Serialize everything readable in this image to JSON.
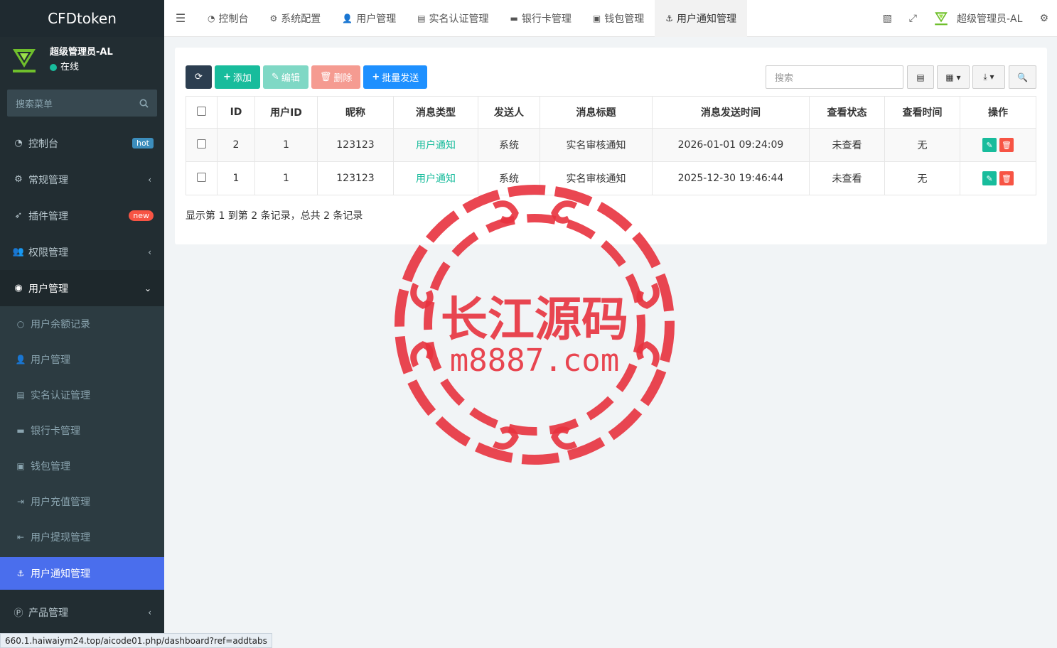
{
  "sidebar": {
    "brand": "CFDtoken",
    "user_name": "超级管理员-AL",
    "user_status": "在线",
    "search_placeholder": "搜索菜单",
    "items": [
      {
        "label": "控制台",
        "icon": "dashboard-icon",
        "badge": "hot"
      },
      {
        "label": "常规管理",
        "icon": "cogs-icon",
        "chevron": "‹"
      },
      {
        "label": "插件管理",
        "icon": "rocket-icon",
        "badge": "new"
      },
      {
        "label": "权限管理",
        "icon": "group-icon",
        "chevron": "‹"
      },
      {
        "label": "用户管理",
        "icon": "user-circle-icon",
        "chevron": "⌄"
      }
    ],
    "subitems": [
      {
        "label": "用户余额记录",
        "icon": "circle-o-icon"
      },
      {
        "label": "用户管理",
        "icon": "user-icon"
      },
      {
        "label": "实名认证管理",
        "icon": "id-card-icon"
      },
      {
        "label": "银行卡管理",
        "icon": "credit-card-icon"
      },
      {
        "label": "钱包管理",
        "icon": "money-icon"
      },
      {
        "label": "用户充值管理",
        "icon": "sign-in-icon"
      },
      {
        "label": "用户提现管理",
        "icon": "sign-out-icon"
      },
      {
        "label": "用户通知管理",
        "icon": "anchor-icon"
      }
    ],
    "last_item": {
      "label": "产品管理",
      "icon": "product-icon",
      "chevron": "‹"
    }
  },
  "topnav": {
    "tabs": [
      {
        "label": "控制台",
        "icon": "dashboard-icon"
      },
      {
        "label": "系统配置",
        "icon": "gear-icon"
      },
      {
        "label": "用户管理",
        "icon": "user-icon"
      },
      {
        "label": "实名认证管理",
        "icon": "id-card-icon"
      },
      {
        "label": "银行卡管理",
        "icon": "credit-card-icon"
      },
      {
        "label": "钱包管理",
        "icon": "money-icon"
      },
      {
        "label": "用户通知管理",
        "icon": "anchor-icon"
      }
    ],
    "admin_name": "超级管理员-AL"
  },
  "toolbar": {
    "add": "添加",
    "edit": "编辑",
    "delete": "删除",
    "batch": "批量发送",
    "search_placeholder": "搜索"
  },
  "table": {
    "headers": [
      "ID",
      "用户ID",
      "昵称",
      "消息类型",
      "发送人",
      "消息标题",
      "消息发送时间",
      "查看状态",
      "查看时间",
      "操作"
    ],
    "rows": [
      {
        "id": "2",
        "user_id": "1",
        "nickname": "123123",
        "type": "用户通知",
        "sender": "系统",
        "title": "实名审核通知",
        "time": "2026-01-01 09:24:09",
        "status": "未查看",
        "view_time": "无"
      },
      {
        "id": "1",
        "user_id": "1",
        "nickname": "123123",
        "type": "用户通知",
        "sender": "系统",
        "title": "实名审核通知",
        "time": "2025-12-30 19:46:44",
        "status": "未查看",
        "view_time": "无"
      }
    ],
    "page_info": "显示第 1 到第 2 条记录，总共 2 条记录"
  },
  "watermark": {
    "line1": "长江源码",
    "line2": "m8887.com"
  },
  "statusbar": {
    "url": "660.1.haiwaiym24.top/aicode01.php/dashboard?ref=addtabs"
  },
  "colors": {
    "sidebar_bg": "#222d32",
    "active_blue": "#4a6eed",
    "green": "#18bc9c",
    "red": "#f75444",
    "watermark_red": "#e8333f"
  }
}
